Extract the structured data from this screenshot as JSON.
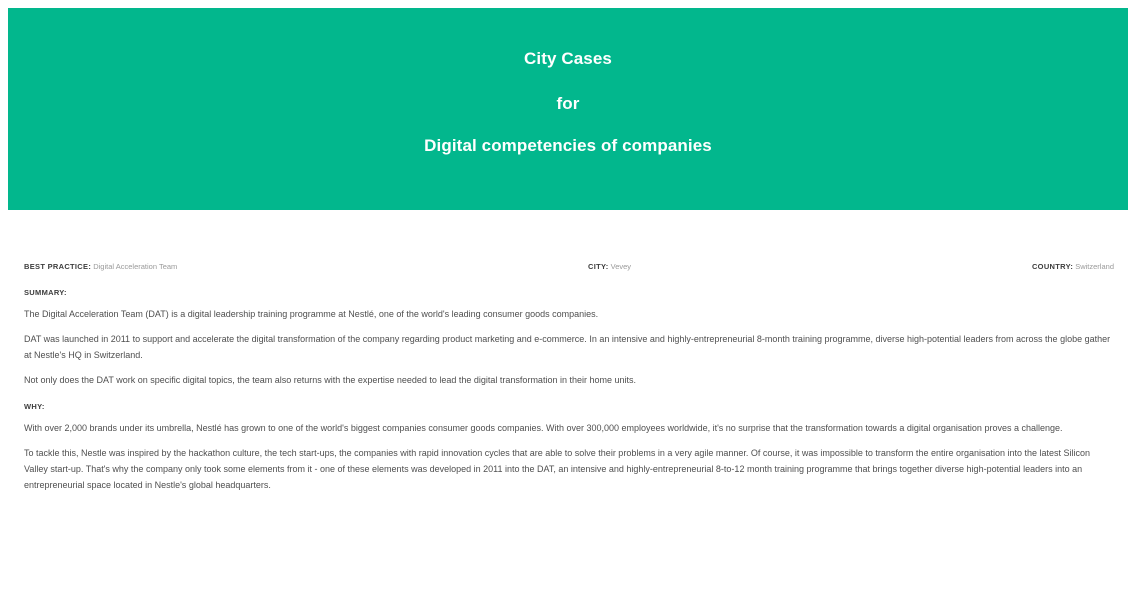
{
  "header": {
    "line1": "City Cases",
    "line2": "for",
    "line3": "Digital competencies of companies"
  },
  "meta": {
    "best_practice_label": "BEST PRACTICE:",
    "best_practice_value": "Digital Acceleration Team",
    "city_label": "CITY:",
    "city_value": "Vevey",
    "country_label": "COUNTRY:",
    "country_value": "Switzerland"
  },
  "summary": {
    "label": "SUMMARY:",
    "paragraphs": [
      "The Digital Acceleration Team (DAT) is a digital leadership training programme at Nestlé, one of the world's leading consumer goods companies.",
      "DAT was launched in 2011 to support and accelerate the digital transformation of the company regarding product marketing and e-commerce. In an intensive and highly-entrepreneurial 8-month training programme, diverse high-potential leaders from across the globe gather at Nestle's HQ in Switzerland.",
      "Not only does the DAT work on specific digital topics, the team also returns with the expertise needed to lead the digital transformation in their home units."
    ]
  },
  "why": {
    "label": "WHY:",
    "paragraphs": [
      "With over 2,000 brands under its umbrella, Nestlé has grown to one of the world's biggest companies consumer goods companies. With over 300,000 employees worldwide, it's no surprise that the transformation towards a digital organisation proves a challenge.",
      "To tackle this, Nestle was inspired by the hackathon culture, the tech start-ups, the companies with rapid innovation cycles that are able to solve their problems in a very agile manner. Of course, it was impossible to transform the entire organisation into the latest Silicon Valley start-up. That's why the company only took some elements from it - one of these elements was developed in 2011 into the DAT, an intensive and highly-entrepreneurial  8-to-12 month training programme that brings together diverse high-potential leaders into an entrepreneurial space located in Nestle's global headquarters."
    ]
  },
  "colors": {
    "header_bg": "#02b78d",
    "header_text": "#ffffff",
    "body_text": "#4f4f4f",
    "meta_value": "#9a9a9a"
  }
}
